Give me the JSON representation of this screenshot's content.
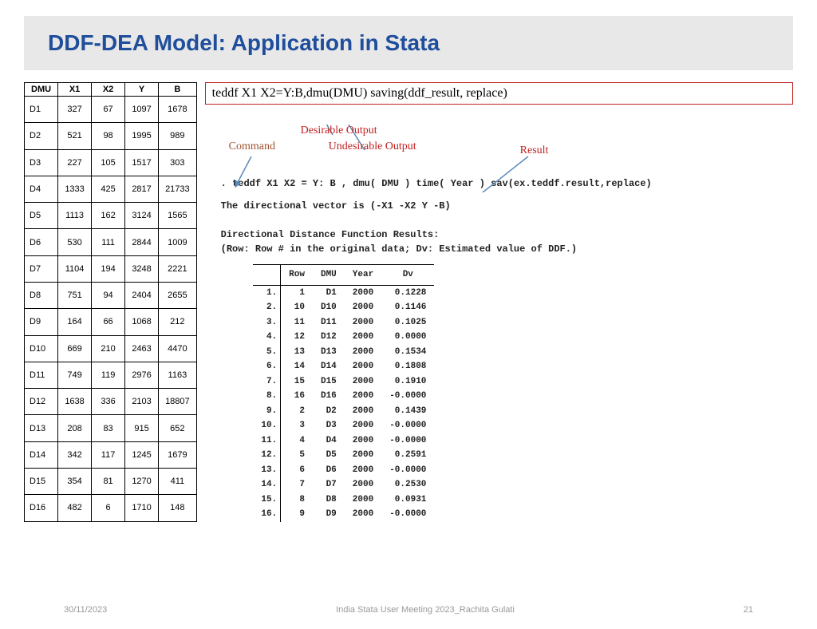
{
  "title": "DDF-DEA Model: Application in Stata",
  "command_summary": "teddf X1 X2=Y:B,dmu(DMU) saving(ddf_result, replace)",
  "labels": {
    "command": "Command",
    "desirable": "Desirable Output",
    "undesirable": "Undesirable Output",
    "result": "Result"
  },
  "stata": {
    "cmd": ". teddf X1 X2 = Y: B , dmu( DMU ) time( Year ) sav(ex.teddf.result,replace)",
    "vector": "The directional vector is (-X1 -X2 Y -B)",
    "hdr1": "Directional Distance Function Results:",
    "hdr2": "   (Row: Row # in the original data; Dv: Estimated value of  DDF.)"
  },
  "data_table": {
    "headers": [
      "DMU",
      "X1",
      "X2",
      "Y",
      "B"
    ],
    "rows": [
      [
        "D1",
        327,
        67,
        1097,
        1678
      ],
      [
        "D2",
        521,
        98,
        1995,
        989
      ],
      [
        "D3",
        227,
        105,
        1517,
        303
      ],
      [
        "D4",
        1333,
        425,
        2817,
        21733
      ],
      [
        "D5",
        1113,
        162,
        3124,
        1565
      ],
      [
        "D6",
        530,
        111,
        2844,
        1009
      ],
      [
        "D7",
        1104,
        194,
        3248,
        2221
      ],
      [
        "D8",
        751,
        94,
        2404,
        2655
      ],
      [
        "D9",
        164,
        66,
        1068,
        212
      ],
      [
        "D10",
        669,
        210,
        2463,
        4470
      ],
      [
        "D11",
        749,
        119,
        2976,
        1163
      ],
      [
        "D12",
        1638,
        336,
        2103,
        18807
      ],
      [
        "D13",
        208,
        83,
        915,
        652
      ],
      [
        "D14",
        342,
        117,
        1245,
        1679
      ],
      [
        "D15",
        354,
        81,
        1270,
        411
      ],
      [
        "D16",
        482,
        6,
        1710,
        148
      ]
    ]
  },
  "results_table": {
    "headers": [
      "",
      "Row",
      "DMU",
      "Year",
      "Dv"
    ],
    "rows": [
      [
        "1.",
        1,
        "D1",
        2000,
        "0.1228"
      ],
      [
        "2.",
        10,
        "D10",
        2000,
        "0.1146"
      ],
      [
        "3.",
        11,
        "D11",
        2000,
        "0.1025"
      ],
      [
        "4.",
        12,
        "D12",
        2000,
        "0.0000"
      ],
      [
        "5.",
        13,
        "D13",
        2000,
        "0.1534"
      ],
      [
        "6.",
        14,
        "D14",
        2000,
        "0.1808"
      ],
      [
        "7.",
        15,
        "D15",
        2000,
        "0.1910"
      ],
      [
        "8.",
        16,
        "D16",
        2000,
        "-0.0000"
      ],
      [
        "9.",
        2,
        "D2",
        2000,
        "0.1439"
      ],
      [
        "10.",
        3,
        "D3",
        2000,
        "-0.0000"
      ],
      [
        "11.",
        4,
        "D4",
        2000,
        "-0.0000"
      ],
      [
        "12.",
        5,
        "D5",
        2000,
        "0.2591"
      ],
      [
        "13.",
        6,
        "D6",
        2000,
        "-0.0000"
      ],
      [
        "14.",
        7,
        "D7",
        2000,
        "0.2530"
      ],
      [
        "15.",
        8,
        "D8",
        2000,
        "0.0931"
      ],
      [
        "16.",
        9,
        "D9",
        2000,
        "-0.0000"
      ]
    ]
  },
  "footer": {
    "date": "30/11/2023",
    "center": "India Stata User Meeting 2023_Rachita Gulati",
    "page": "21"
  }
}
